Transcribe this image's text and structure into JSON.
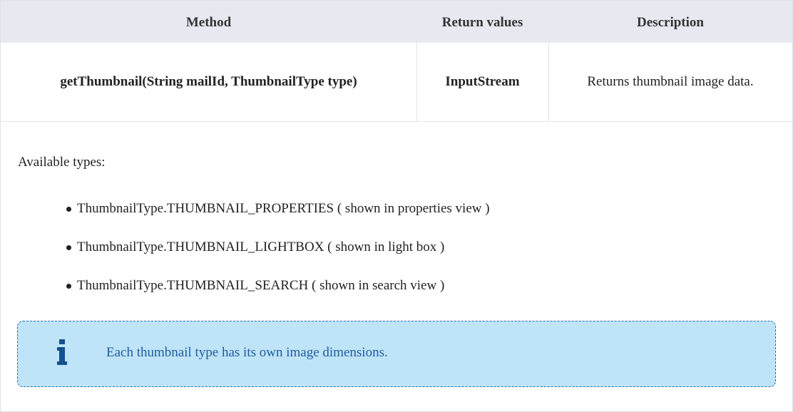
{
  "table": {
    "headers": [
      "Method",
      "Return values",
      "Description"
    ],
    "row": {
      "method": "getThumbnail(String mailId, ThumbnailType type)",
      "return_value": "InputStream",
      "description": "Returns thumbnail image data."
    }
  },
  "notes": {
    "intro": "Available types:",
    "types": [
      "ThumbnailType.THUMBNAIL_PROPERTIES ( shown in properties view )",
      "ThumbnailType.THUMBNAIL_LIGHTBOX ( shown in light box )",
      "ThumbnailType.THUMBNAIL_SEARCH ( shown in search view )"
    ],
    "info": {
      "icon": "info-icon",
      "text": "Each thumbnail type has its own image dimensions.",
      "accent": "#1f5c9e",
      "background": "#bfe4f7"
    }
  }
}
